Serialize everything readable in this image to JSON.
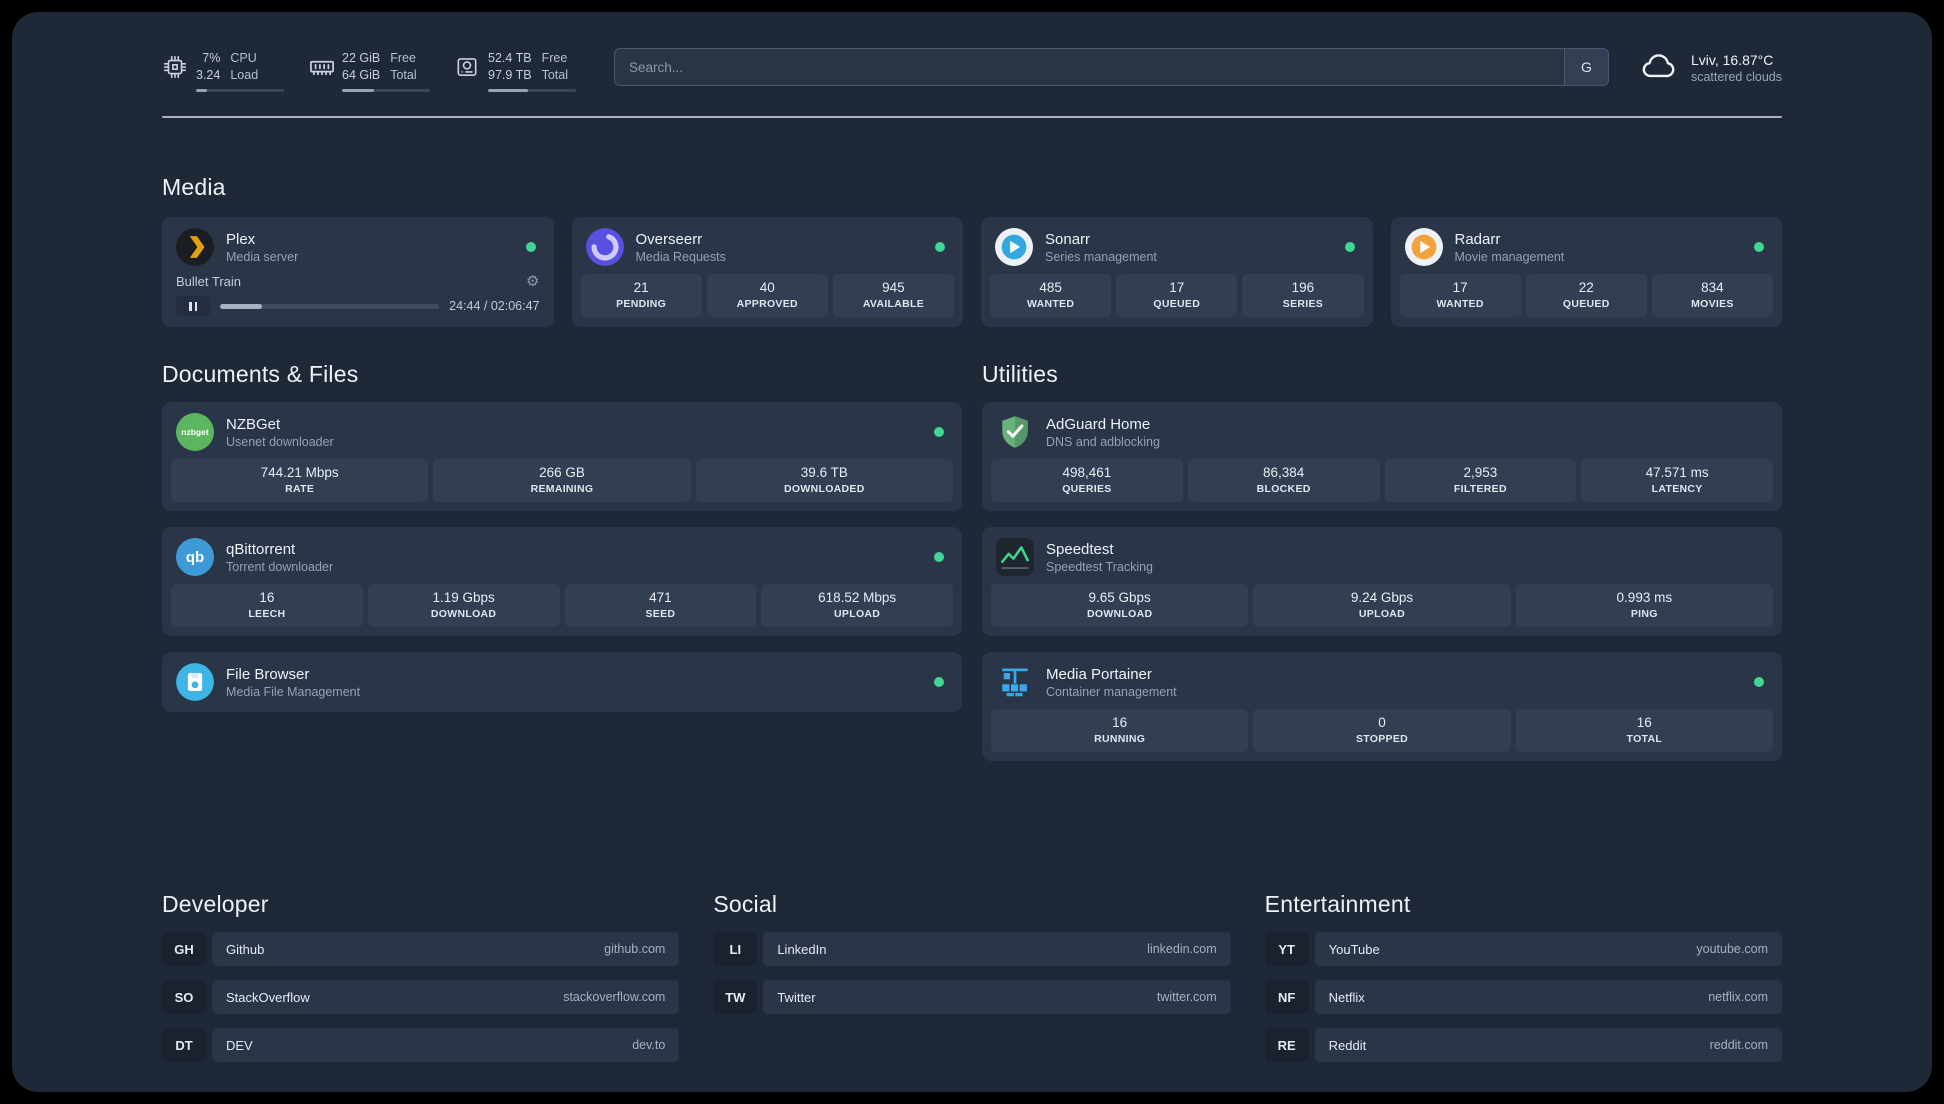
{
  "colors": {
    "background": "#1e2837",
    "card": "#2a3548",
    "status_online": "#41d693",
    "accent_plex": "#e5a00d"
  },
  "topbar": {
    "cpu": {
      "line1": "7%",
      "line2": "3.24",
      "label1": "CPU",
      "label2": "Load",
      "progress": 12
    },
    "memory": {
      "line1": "22 GiB",
      "line2": "64 GiB",
      "label1": "Free",
      "label2": "Total",
      "progress": 36
    },
    "disk": {
      "line1": "52.4 TB",
      "line2": "97.9 TB",
      "label1": "Free",
      "label2": "Total",
      "progress": 46
    },
    "search": {
      "placeholder": "Search...",
      "engine_button": "G"
    },
    "weather": {
      "location": "Lviv, 16.87°C",
      "condition": "scattered clouds"
    }
  },
  "sections": {
    "media": {
      "title": "Media",
      "plex": {
        "name": "Plex",
        "subtitle": "Media server",
        "now_playing": "Bullet Train",
        "time": "24:44 / 02:06:47",
        "progress": 19
      },
      "overseerr": {
        "name": "Overseerr",
        "subtitle": "Media Requests",
        "stats": [
          {
            "value": "21",
            "label": "PENDING"
          },
          {
            "value": "40",
            "label": "APPROVED"
          },
          {
            "value": "945",
            "label": "AVAILABLE"
          }
        ]
      },
      "sonarr": {
        "name": "Sonarr",
        "subtitle": "Series management",
        "stats": [
          {
            "value": "485",
            "label": "WANTED"
          },
          {
            "value": "17",
            "label": "QUEUED"
          },
          {
            "value": "196",
            "label": "SERIES"
          }
        ]
      },
      "radarr": {
        "name": "Radarr",
        "subtitle": "Movie management",
        "stats": [
          {
            "value": "17",
            "label": "WANTED"
          },
          {
            "value": "22",
            "label": "QUEUED"
          },
          {
            "value": "834",
            "label": "MOVIES"
          }
        ]
      }
    },
    "documents": {
      "title": "Documents & Files",
      "nzbget": {
        "name": "NZBGet",
        "subtitle": "Usenet downloader",
        "icon_text": "nzbget",
        "stats": [
          {
            "value": "744.21 Mbps",
            "label": "RATE"
          },
          {
            "value": "266 GB",
            "label": "REMAINING"
          },
          {
            "value": "39.6 TB",
            "label": "DOWNLOADED"
          }
        ]
      },
      "qbittorrent": {
        "name": "qBittorrent",
        "subtitle": "Torrent downloader",
        "icon_text": "qb",
        "stats": [
          {
            "value": "16",
            "label": "LEECH"
          },
          {
            "value": "1.19 Gbps",
            "label": "DOWNLOAD"
          },
          {
            "value": "471",
            "label": "SEED"
          },
          {
            "value": "618.52 Mbps",
            "label": "UPLOAD"
          }
        ]
      },
      "filebrowser": {
        "name": "File Browser",
        "subtitle": "Media File Management"
      }
    },
    "utilities": {
      "title": "Utilities",
      "adguard": {
        "name": "AdGuard Home",
        "subtitle": "DNS and adblocking",
        "stats": [
          {
            "value": "498,461",
            "label": "QUERIES"
          },
          {
            "value": "86,384",
            "label": "BLOCKED"
          },
          {
            "value": "2,953",
            "label": "FILTERED"
          },
          {
            "value": "47.571 ms",
            "label": "LATENCY"
          }
        ]
      },
      "speedtest": {
        "name": "Speedtest",
        "subtitle": "Speedtest Tracking",
        "stats": [
          {
            "value": "9.65 Gbps",
            "label": "DOWNLOAD"
          },
          {
            "value": "9.24 Gbps",
            "label": "UPLOAD"
          },
          {
            "value": "0.993 ms",
            "label": "PING"
          }
        ]
      },
      "portainer": {
        "name": "Media Portainer",
        "subtitle": "Container management",
        "stats": [
          {
            "value": "16",
            "label": "RUNNING"
          },
          {
            "value": "0",
            "label": "STOPPED"
          },
          {
            "value": "16",
            "label": "TOTAL"
          }
        ]
      }
    },
    "bookmarks": {
      "developer": {
        "title": "Developer",
        "items": [
          {
            "abbr": "GH",
            "name": "Github",
            "url": "github.com"
          },
          {
            "abbr": "SO",
            "name": "StackOverflow",
            "url": "stackoverflow.com"
          },
          {
            "abbr": "DT",
            "name": "DEV",
            "url": "dev.to"
          }
        ]
      },
      "social": {
        "title": "Social",
        "items": [
          {
            "abbr": "LI",
            "name": "LinkedIn",
            "url": "linkedin.com"
          },
          {
            "abbr": "TW",
            "name": "Twitter",
            "url": "twitter.com"
          }
        ]
      },
      "entertainment": {
        "title": "Entertainment",
        "items": [
          {
            "abbr": "YT",
            "name": "YouTube",
            "url": "youtube.com"
          },
          {
            "abbr": "NF",
            "name": "Netflix",
            "url": "netflix.com"
          },
          {
            "abbr": "RE",
            "name": "Reddit",
            "url": "reddit.com"
          }
        ]
      }
    }
  }
}
